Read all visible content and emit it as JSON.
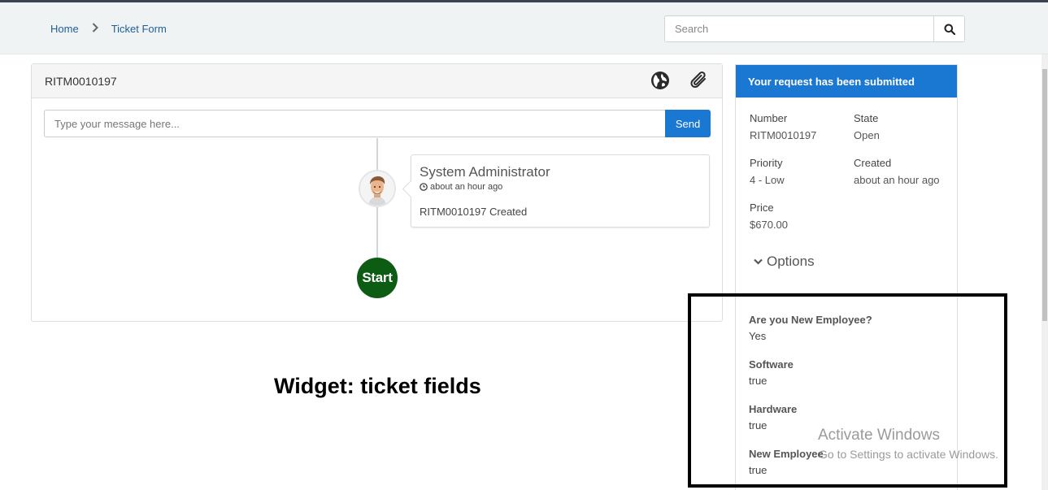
{
  "breadcrumb": {
    "home": "Home",
    "current": "Ticket Form"
  },
  "search": {
    "placeholder": "Search"
  },
  "ticket": {
    "id": "RITM0010197",
    "message_placeholder": "Type your message here...",
    "send_label": "Send",
    "timeline": {
      "author": "System Administrator",
      "time": "about an hour ago",
      "text": "RITM0010197 Created",
      "start_label": "Start"
    }
  },
  "annotation": "Widget: ticket fields",
  "side": {
    "header": "Your request has been submitted",
    "number_label": "Number",
    "number": "RITM0010197",
    "state_label": "State",
    "state": "Open",
    "priority_label": "Priority",
    "priority": "4 - Low",
    "created_label": "Created",
    "created": "about an hour ago",
    "price_label": "Price",
    "price": "$670.00",
    "options_label": "Options",
    "variables": [
      {
        "label": "Are you New Employee?",
        "value": "Yes"
      },
      {
        "label": "Software",
        "value": "true"
      },
      {
        "label": "Hardware",
        "value": "true"
      },
      {
        "label": "New Employee",
        "value": "true"
      }
    ]
  },
  "watermark": {
    "title": "Activate Windows",
    "subtitle": "Go to Settings to activate Windows."
  },
  "colors": {
    "accent": "#1a77d2",
    "start_node": "#0d5c14"
  }
}
